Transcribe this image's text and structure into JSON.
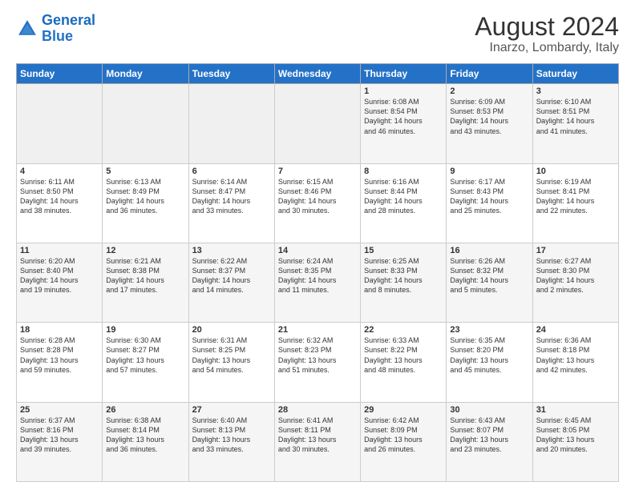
{
  "header": {
    "logo_general": "General",
    "logo_blue": "Blue",
    "title": "August 2024",
    "subtitle": "Inarzo, Lombardy, Italy"
  },
  "days_of_week": [
    "Sunday",
    "Monday",
    "Tuesday",
    "Wednesday",
    "Thursday",
    "Friday",
    "Saturday"
  ],
  "weeks": [
    [
      {
        "day": "",
        "info": ""
      },
      {
        "day": "",
        "info": ""
      },
      {
        "day": "",
        "info": ""
      },
      {
        "day": "",
        "info": ""
      },
      {
        "day": "1",
        "info": "Sunrise: 6:08 AM\nSunset: 8:54 PM\nDaylight: 14 hours\nand 46 minutes."
      },
      {
        "day": "2",
        "info": "Sunrise: 6:09 AM\nSunset: 8:53 PM\nDaylight: 14 hours\nand 43 minutes."
      },
      {
        "day": "3",
        "info": "Sunrise: 6:10 AM\nSunset: 8:51 PM\nDaylight: 14 hours\nand 41 minutes."
      }
    ],
    [
      {
        "day": "4",
        "info": "Sunrise: 6:11 AM\nSunset: 8:50 PM\nDaylight: 14 hours\nand 38 minutes."
      },
      {
        "day": "5",
        "info": "Sunrise: 6:13 AM\nSunset: 8:49 PM\nDaylight: 14 hours\nand 36 minutes."
      },
      {
        "day": "6",
        "info": "Sunrise: 6:14 AM\nSunset: 8:47 PM\nDaylight: 14 hours\nand 33 minutes."
      },
      {
        "day": "7",
        "info": "Sunrise: 6:15 AM\nSunset: 8:46 PM\nDaylight: 14 hours\nand 30 minutes."
      },
      {
        "day": "8",
        "info": "Sunrise: 6:16 AM\nSunset: 8:44 PM\nDaylight: 14 hours\nand 28 minutes."
      },
      {
        "day": "9",
        "info": "Sunrise: 6:17 AM\nSunset: 8:43 PM\nDaylight: 14 hours\nand 25 minutes."
      },
      {
        "day": "10",
        "info": "Sunrise: 6:19 AM\nSunset: 8:41 PM\nDaylight: 14 hours\nand 22 minutes."
      }
    ],
    [
      {
        "day": "11",
        "info": "Sunrise: 6:20 AM\nSunset: 8:40 PM\nDaylight: 14 hours\nand 19 minutes."
      },
      {
        "day": "12",
        "info": "Sunrise: 6:21 AM\nSunset: 8:38 PM\nDaylight: 14 hours\nand 17 minutes."
      },
      {
        "day": "13",
        "info": "Sunrise: 6:22 AM\nSunset: 8:37 PM\nDaylight: 14 hours\nand 14 minutes."
      },
      {
        "day": "14",
        "info": "Sunrise: 6:24 AM\nSunset: 8:35 PM\nDaylight: 14 hours\nand 11 minutes."
      },
      {
        "day": "15",
        "info": "Sunrise: 6:25 AM\nSunset: 8:33 PM\nDaylight: 14 hours\nand 8 minutes."
      },
      {
        "day": "16",
        "info": "Sunrise: 6:26 AM\nSunset: 8:32 PM\nDaylight: 14 hours\nand 5 minutes."
      },
      {
        "day": "17",
        "info": "Sunrise: 6:27 AM\nSunset: 8:30 PM\nDaylight: 14 hours\nand 2 minutes."
      }
    ],
    [
      {
        "day": "18",
        "info": "Sunrise: 6:28 AM\nSunset: 8:28 PM\nDaylight: 13 hours\nand 59 minutes."
      },
      {
        "day": "19",
        "info": "Sunrise: 6:30 AM\nSunset: 8:27 PM\nDaylight: 13 hours\nand 57 minutes."
      },
      {
        "day": "20",
        "info": "Sunrise: 6:31 AM\nSunset: 8:25 PM\nDaylight: 13 hours\nand 54 minutes."
      },
      {
        "day": "21",
        "info": "Sunrise: 6:32 AM\nSunset: 8:23 PM\nDaylight: 13 hours\nand 51 minutes."
      },
      {
        "day": "22",
        "info": "Sunrise: 6:33 AM\nSunset: 8:22 PM\nDaylight: 13 hours\nand 48 minutes."
      },
      {
        "day": "23",
        "info": "Sunrise: 6:35 AM\nSunset: 8:20 PM\nDaylight: 13 hours\nand 45 minutes."
      },
      {
        "day": "24",
        "info": "Sunrise: 6:36 AM\nSunset: 8:18 PM\nDaylight: 13 hours\nand 42 minutes."
      }
    ],
    [
      {
        "day": "25",
        "info": "Sunrise: 6:37 AM\nSunset: 8:16 PM\nDaylight: 13 hours\nand 39 minutes."
      },
      {
        "day": "26",
        "info": "Sunrise: 6:38 AM\nSunset: 8:14 PM\nDaylight: 13 hours\nand 36 minutes."
      },
      {
        "day": "27",
        "info": "Sunrise: 6:40 AM\nSunset: 8:13 PM\nDaylight: 13 hours\nand 33 minutes."
      },
      {
        "day": "28",
        "info": "Sunrise: 6:41 AM\nSunset: 8:11 PM\nDaylight: 13 hours\nand 30 minutes."
      },
      {
        "day": "29",
        "info": "Sunrise: 6:42 AM\nSunset: 8:09 PM\nDaylight: 13 hours\nand 26 minutes."
      },
      {
        "day": "30",
        "info": "Sunrise: 6:43 AM\nSunset: 8:07 PM\nDaylight: 13 hours\nand 23 minutes."
      },
      {
        "day": "31",
        "info": "Sunrise: 6:45 AM\nSunset: 8:05 PM\nDaylight: 13 hours\nand 20 minutes."
      }
    ]
  ]
}
